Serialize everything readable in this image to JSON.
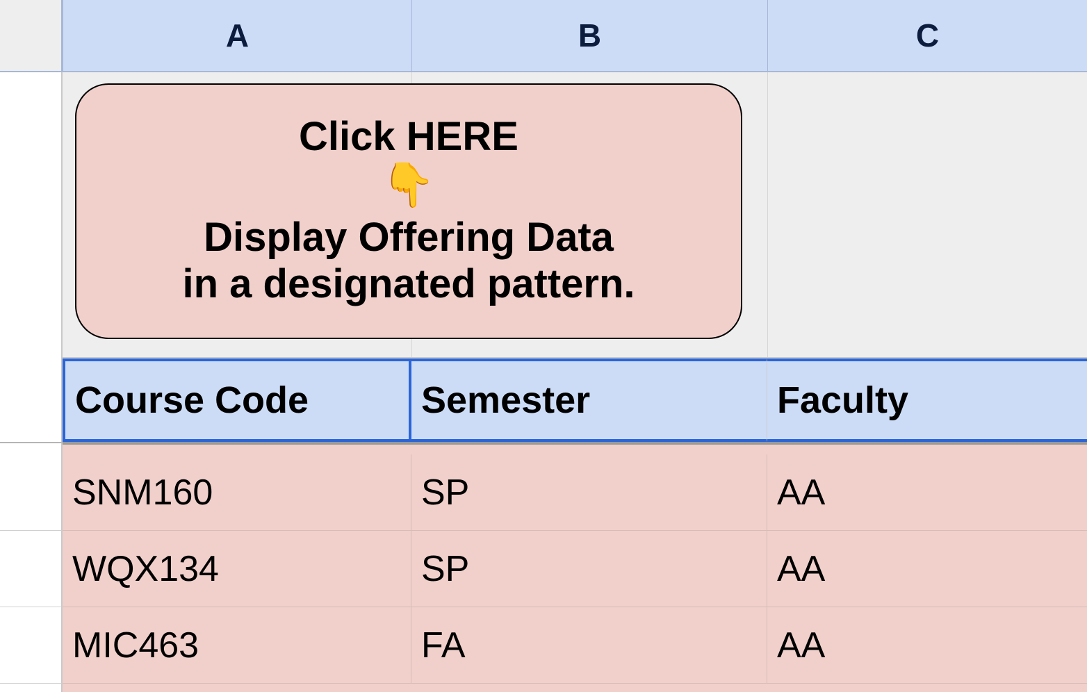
{
  "columns": {
    "A": "A",
    "B": "B",
    "C": "C"
  },
  "click_box": {
    "title": "Click HERE",
    "emoji": "👇",
    "desc_line1": "Display Offering Data",
    "desc_line2": "in a designated pattern."
  },
  "headers": {
    "course_code": "Course Code",
    "semester": "Semester",
    "faculty": "Faculty"
  },
  "rows": [
    {
      "course_code": "SNM160",
      "semester": "SP",
      "faculty": "AA"
    },
    {
      "course_code": "WQX134",
      "semester": "SP",
      "faculty": "AA"
    },
    {
      "course_code": "MIC463",
      "semester": "FA",
      "faculty": "AA"
    }
  ]
}
